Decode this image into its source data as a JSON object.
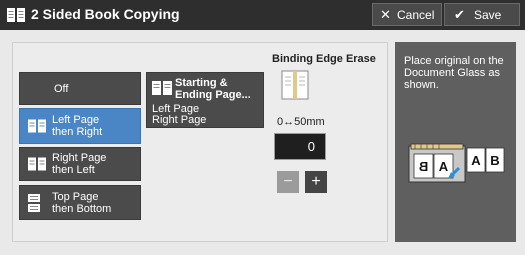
{
  "header": {
    "title": "2 Sided Book Copying",
    "cancel_label": "Cancel",
    "save_label": "Save"
  },
  "options": [
    {
      "label_line1": "Off",
      "label_line2": "",
      "selected": false
    },
    {
      "label_line1": "Left Page",
      "label_line2": "then Right",
      "selected": true
    },
    {
      "label_line1": "Right Page",
      "label_line2": "then Left",
      "selected": false
    },
    {
      "label_line1": "Top Page",
      "label_line2": "then Bottom",
      "selected": false
    }
  ],
  "start_end": {
    "title_line1": "Starting &",
    "title_line2": "Ending Page...",
    "value_line1": "Left Page",
    "value_line2": "Right Page"
  },
  "binding_edge": {
    "label": "Binding Edge Erase",
    "range": "0↔50mm",
    "value": "0"
  },
  "info": {
    "text": "Place original on the Document Glass as shown.",
    "illustration_letters": [
      "B",
      "A",
      "A",
      "B"
    ]
  },
  "icons": {
    "title": "open-book-icon",
    "cancel": "close-icon",
    "save": "checkmark-icon"
  },
  "colors": {
    "selected": "#4a86c5",
    "button": "#4b4b4b",
    "titlebar": "#2e2e2e",
    "info_panel": "#5f5f5f"
  }
}
